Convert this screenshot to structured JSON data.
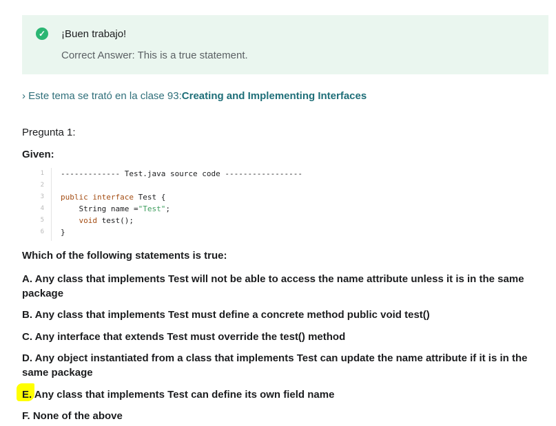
{
  "feedback": {
    "title": "¡Buen trabajo!",
    "answer": "Correct Answer: This is a true statement.",
    "icon": "check-circle-icon",
    "color": "#2bb673"
  },
  "topic": {
    "prefix": "› Este tema se trató en la clase 93:",
    "link": "Creating and Implementing Interfaces"
  },
  "question": {
    "label": "Pregunta 1:",
    "given": "Given:",
    "prompt": "Which of the following statements is true:"
  },
  "code": {
    "line_numbers": [
      "1",
      "2",
      "3",
      "4",
      "5",
      "6"
    ],
    "line1": "------------- Test.java source code -----------------",
    "line3_kw": "public interface",
    "line3_rest": " Test {",
    "line4_a": "    String name =",
    "line4_str": "\"Test\"",
    "line4_b": ";",
    "line5_kw": "    void",
    "line5_rest": " test();",
    "line6": "}"
  },
  "options": [
    "A.  Any class that implements Test will not be able to access the name attribute unless it is in the same package",
    "B.  Any class that implements Test must define a concrete method public void test()",
    "C.  Any interface that extends Test must override the test() method",
    "D.  Any object instantiated from a class that implements Test can update the name attribute if it is in the same package",
    "E.  Any class that implements Test can define its own field name",
    "F.  None of the above"
  ]
}
